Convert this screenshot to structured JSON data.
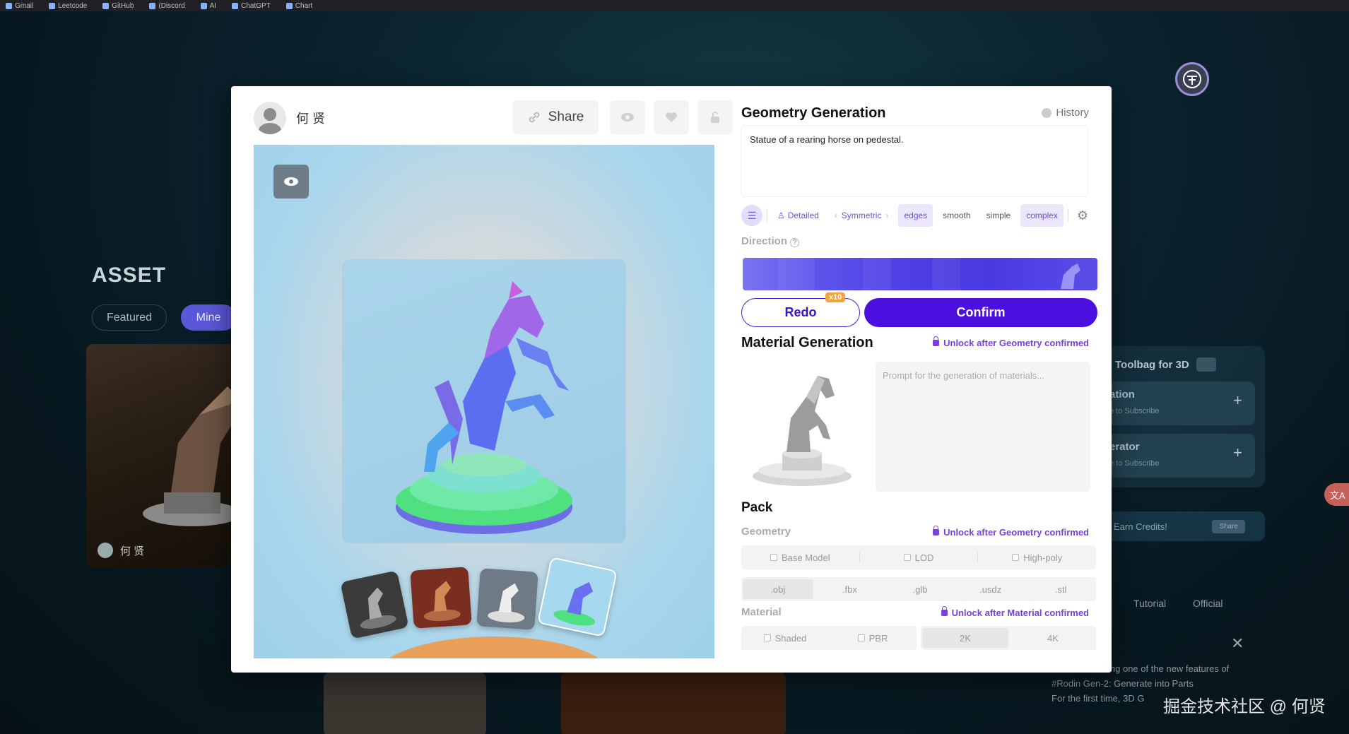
{
  "bookmarks": [
    "Gmail",
    "Leetcode",
    "GitHub",
    "(Discord",
    "AI",
    "ChatGPT",
    "Chart"
  ],
  "background": {
    "section_title": "ASSET",
    "tabs": [
      "Featured",
      "Mine"
    ],
    "card_author": "何 贤",
    "side_header": "Toolbag for 3D",
    "side_items": [
      {
        "title": "ation",
        "subtitle": "e to Subscribe"
      },
      {
        "title": "erator",
        "subtitle": "e to Subscribe"
      }
    ],
    "earn_credits": "Earn Credits!",
    "share_chip": "Share",
    "links": [
      "Tutorial",
      "Official"
    ],
    "tweet_lines": [
      "ing one of the new features of",
      "#Rodin Gen-2: Generate into Parts",
      "For the first time, 3D G"
    ],
    "watermark": "掘金技术社区 @ 何贤"
  },
  "modal": {
    "user_name": "何 贤",
    "share_label": "Share",
    "geometry": {
      "title": "Geometry Generation",
      "history_label": "History",
      "prompt": "Statue of a rearing horse on pedestal.",
      "tags": [
        "Detailed",
        "Symmetric",
        "edges",
        "smooth",
        "simple",
        "complex"
      ],
      "direction_label": "Direction",
      "redo_label": "Redo",
      "redo_badge": "x10",
      "confirm_label": "Confirm"
    },
    "material": {
      "title": "Material Generation",
      "unlock_text": "Unlock after Geometry confirmed",
      "prompt_placeholder": "Prompt for the generation of materials..."
    },
    "pack": {
      "title": "Pack",
      "geometry_label": "Geometry",
      "geometry_unlock": "Unlock after Geometry confirmed",
      "geometry_options": [
        "Base Model",
        "LOD",
        "High-poly"
      ],
      "formats": [
        ".obj",
        ".fbx",
        ".glb",
        ".usdz",
        ".stl"
      ],
      "material_label": "Material",
      "material_unlock": "Unlock after Material confirmed",
      "material_options": [
        "Shaded",
        "PBR"
      ],
      "resolutions": [
        "2K",
        "4K"
      ]
    }
  },
  "colors": {
    "primary": "#4b0fe0",
    "accent_purple": "#7a3fe0",
    "badge_orange": "#f2a33a"
  }
}
